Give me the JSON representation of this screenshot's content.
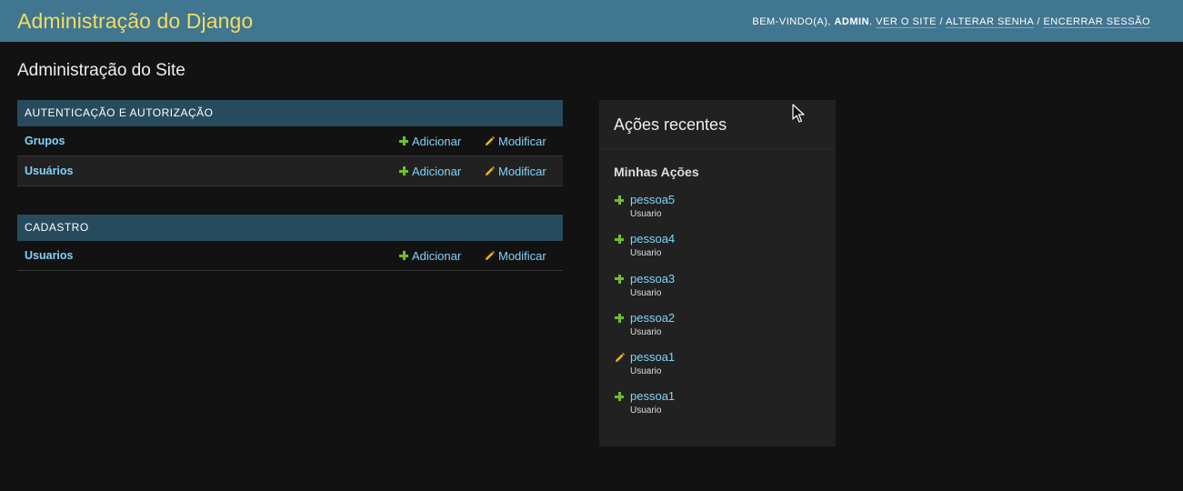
{
  "header": {
    "site_name": "Administração do Django",
    "welcome": "Bem-vindo(a),",
    "username": "admin",
    "links": [
      {
        "label": "Ver o site"
      },
      {
        "label": "Alterar senha"
      },
      {
        "label": "Encerrar sessão"
      }
    ],
    "separator": "/"
  },
  "page": {
    "title": "Administração do Site"
  },
  "apps": [
    {
      "caption": "Autenticação e Autorização",
      "models": [
        {
          "name": "Grupos",
          "add_label": "Adicionar",
          "change_label": "Modificar"
        },
        {
          "name": "Usuários",
          "add_label": "Adicionar",
          "change_label": "Modificar"
        }
      ]
    },
    {
      "caption": "Cadastro",
      "models": [
        {
          "name": "Usuarios",
          "add_label": "Adicionar",
          "change_label": "Modificar"
        }
      ]
    }
  ],
  "recent_actions": {
    "title": "Ações recentes",
    "subtitle": "Minhas Ações",
    "items": [
      {
        "name": "pessoa5",
        "type": "Usuario",
        "action_icon": "plus-icon"
      },
      {
        "name": "pessoa4",
        "type": "Usuario",
        "action_icon": "plus-icon"
      },
      {
        "name": "pessoa3",
        "type": "Usuario",
        "action_icon": "plus-icon"
      },
      {
        "name": "pessoa2",
        "type": "Usuario",
        "action_icon": "plus-icon"
      },
      {
        "name": "pessoa1",
        "type": "Usuario",
        "action_icon": "pencil-icon"
      },
      {
        "name": "pessoa1",
        "type": "Usuario",
        "action_icon": "plus-icon"
      }
    ]
  },
  "colors": {
    "header_bg": "#417690",
    "site_name": "#f5dd5d",
    "caption_bg": "#264b5d",
    "link": "#81d4fa",
    "add_green": "#70bf2b",
    "change_yellow": "#efb80b",
    "page_bg": "#121212",
    "panel_bg": "#212121"
  }
}
